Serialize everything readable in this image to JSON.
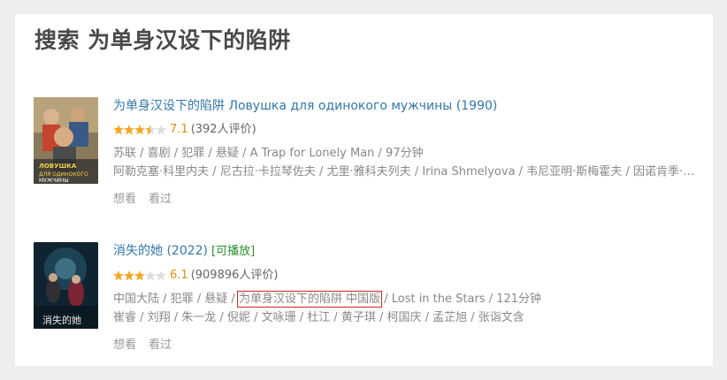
{
  "page": {
    "title": "搜索 为单身汉设下的陷阱"
  },
  "colors": {
    "link": "#3377aa",
    "score": "#e09015",
    "playable": "#2a8c2a",
    "highlight": "#c62828",
    "background": "#eeeeee"
  },
  "results": [
    {
      "title": "为单身汉设下的陷阱 Ловушка для одинокого мужчины (1990)",
      "playable_label": "",
      "rating": 7.1,
      "rating_text": "7.1",
      "stars": 3.5,
      "votes_text": "(392人评价)",
      "meta": "苏联 / 喜剧 / 犯罪 / 悬疑 / A Trap for Lonely Man / 97分钟",
      "cast": "阿勒克塞·科里内夫 / 尼古拉·卡拉琴佐夫 / 尤里·雅科夫列夫 / Irina Shmelyova / 韦尼亚明·斯梅霍夫 / 因诺肯季·斯莫克图诺夫斯基",
      "actions": [
        "想看",
        "看过"
      ],
      "poster_icon": "poster-image"
    },
    {
      "title": "消失的她 (2022)",
      "playable_label": "[可播放]",
      "rating": 6.1,
      "rating_text": "6.1",
      "stars": 3,
      "votes_text": "(909896人评价)",
      "meta_before": "中国大陆 / 犯罪 / 悬疑 / ",
      "meta_highlight": "为单身汉设下的陷阱 中国版",
      "meta_after": " / Lost in the Stars / 121分钟",
      "cast": "崔睿 / 刘翔 / 朱一龙 / 倪妮 / 文咏珊 / 杜江 / 黄子琪 / 柯国庆 / 孟芷旭 / 张诣文含",
      "actions": [
        "想看",
        "看过"
      ],
      "poster_icon": "poster-image"
    }
  ]
}
